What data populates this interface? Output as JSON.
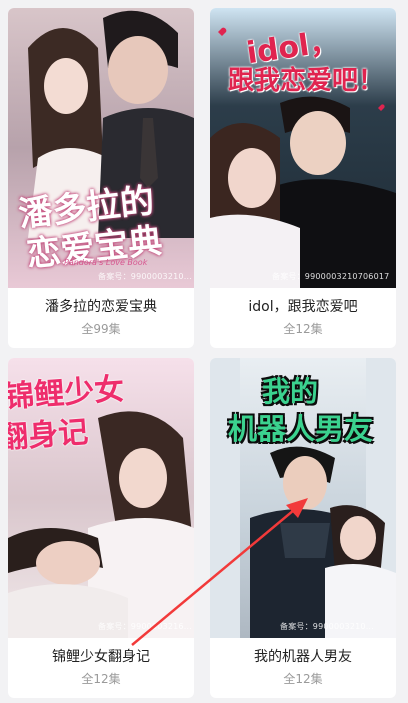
{
  "cards": [
    {
      "title": "潘多拉的恋爱宝典",
      "episodes": "全99集",
      "poster_text_1": "潘多拉的",
      "poster_text_2": "恋爱宝典",
      "poster_sub": "Pandora's Love Book",
      "watermark": "备案号：9900003210...",
      "colors": {
        "bg": "#f3d7df",
        "text": "#ffffff",
        "stroke": "#c2487a"
      }
    },
    {
      "title": "idol，跟我恋爱吧",
      "episodes": "全12集",
      "poster_text_1": "idol，",
      "poster_text_2": "跟我恋爱吧！",
      "watermark": "备案号：9900003210706017",
      "colors": {
        "bg": "#cfe4f2",
        "text": "#e0244f",
        "stroke": "#ffffff"
      }
    },
    {
      "title": "锦鲤少女翻身记",
      "episodes": "全12集",
      "poster_text_1": "锦鲤少女",
      "poster_text_2": "翻身记",
      "watermark": "备案号：9900003216...",
      "colors": {
        "bg": "#f6e0ea",
        "text": "#ee2d6c",
        "stroke": "#ffffff"
      }
    },
    {
      "title": "我的机器人男友",
      "episodes": "全12集",
      "poster_text_1": "我的",
      "poster_text_2": "机器人男友",
      "watermark": "备案号：9900003210...",
      "colors": {
        "bg": "#e9eef2",
        "text": "#3bd28f",
        "stroke": "#0c0c0c"
      }
    }
  ]
}
